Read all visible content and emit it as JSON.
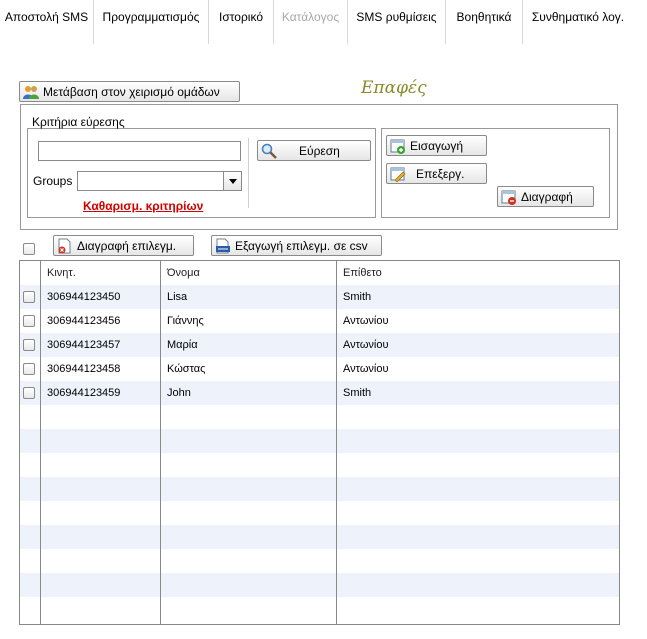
{
  "menu": [
    {
      "label": "Αποστολή SMS",
      "disabled": false
    },
    {
      "label": "Προγραμματισμός",
      "disabled": false
    },
    {
      "label": "Ιστορικό",
      "disabled": false
    },
    {
      "label": "Κατάλογος",
      "disabled": true
    },
    {
      "label": "SMS ρυθμίσεις",
      "disabled": false
    },
    {
      "label": "Βοηθητικά",
      "disabled": false
    },
    {
      "label": "Συνθηματικό λογ.",
      "disabled": false
    }
  ],
  "groups_button": "Μετάβαση στον χειρισμό ομάδων",
  "page_title": "Επαφές",
  "search": {
    "legend": "Κριτήρια εύρεσης",
    "text_value": "",
    "groups_label": "Groups",
    "groups_value": "",
    "search_button": "Εύρεση",
    "clear_link": "Καθαρισμ. κριτηρίων"
  },
  "actions": {
    "insert": "Εισαγωγή",
    "edit": "Επεξεργ.",
    "delete": "Διαγραφή"
  },
  "toolbar": {
    "delete_selected": "Διαγραφή επιλεγμ.",
    "export_csv": "Εξαγωγή επιλεγμ. σε csv"
  },
  "table": {
    "columns": [
      "Κινητ.",
      "Όνομα",
      "Επίθετο"
    ],
    "rows": [
      {
        "mobile": "306944123450",
        "first": "Lisa",
        "last": "Smith"
      },
      {
        "mobile": "306944123456",
        "first": "Γιάννης",
        "last": "Αντωνίου"
      },
      {
        "mobile": "306944123457",
        "first": "Μαρία",
        "last": "Αντωνίου"
      },
      {
        "mobile": "306944123458",
        "first": "Κώστας",
        "last": "Αντωνίου"
      },
      {
        "mobile": "306944123459",
        "first": "John",
        "last": "Smith"
      }
    ],
    "empty_rows": 9
  }
}
